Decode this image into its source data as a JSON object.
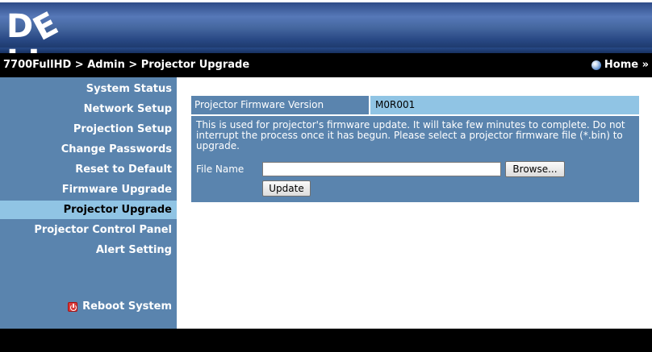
{
  "brand": {
    "logo_text_pre": "D",
    "logo_text_e": "E",
    "logo_text_post": "LL"
  },
  "navbar": {
    "breadcrumb": "7700FullHD > Admin > Projector Upgrade",
    "home_label": "Home »"
  },
  "sidebar": {
    "items": [
      {
        "label": "System Status"
      },
      {
        "label": "Network Setup"
      },
      {
        "label": "Projection Setup"
      },
      {
        "label": "Change Passwords"
      },
      {
        "label": "Reset to Default"
      },
      {
        "label": "Firmware Upgrade"
      },
      {
        "label": "Projector Upgrade"
      },
      {
        "label": "Projector Control Panel"
      },
      {
        "label": "Alert Setting"
      }
    ],
    "active_index": 6,
    "reboot_label": "Reboot System"
  },
  "main": {
    "fw_version_label": "Projector Firmware Version",
    "fw_version_value": "M0R001",
    "description": "This is used for projector's firmware update. It will take few minutes to complete. Do not interrupt the process once it has begun. Please select a projector firmware file (*.bin) to upgrade.",
    "file_name_label": "File Name",
    "file_name_value": "",
    "browse_label": "Browse...",
    "update_label": "Update"
  },
  "colors": {
    "banner_blue": "#3d5e9e",
    "sidebar_blue": "#5a84ae",
    "active_light_blue": "#90c4e4",
    "bar_black": "#000000"
  },
  "icons": [
    "home-orb-icon",
    "power-icon"
  ]
}
